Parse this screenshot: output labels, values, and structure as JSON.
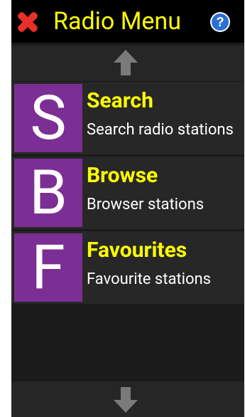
{
  "header": {
    "title": "Radio Menu",
    "close_icon": "close-icon",
    "help_icon": "help-icon",
    "help_glyph": "?"
  },
  "scroll": {
    "up_icon": "arrow-up-icon",
    "down_icon": "arrow-down-icon"
  },
  "menu": {
    "items": [
      {
        "letter": "S",
        "title": "Search",
        "subtitle": "Search radio stations"
      },
      {
        "letter": "B",
        "title": "Browse",
        "subtitle": "Browser stations"
      },
      {
        "letter": "F",
        "title": "Favourites",
        "subtitle": "Favourite stations"
      }
    ]
  },
  "colors": {
    "title_text": "#ffff00",
    "tile_bg": "#7b2e94",
    "close_red": "#e8302a",
    "help_blue": "#2b6fd6",
    "arrow_grey": "#7a7a7a",
    "background": "#1b1b1b"
  }
}
